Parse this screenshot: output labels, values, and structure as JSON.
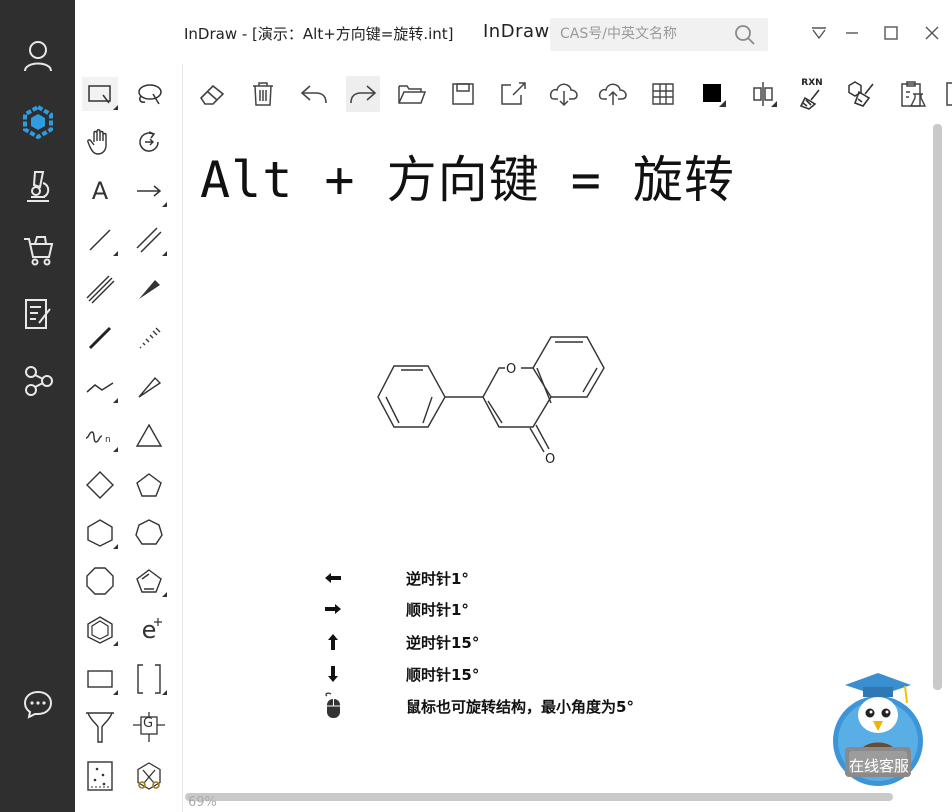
{
  "window": {
    "doc_title": "InDraw - [演示：Alt+方向键=旋转.int]",
    "brand": "InDraw",
    "search_placeholder": "CAS号/中英文名称"
  },
  "nav": {
    "items": [
      {
        "icon": "user-icon"
      },
      {
        "icon": "molecule-logo-icon",
        "active": true
      },
      {
        "icon": "microscope-icon"
      },
      {
        "icon": "cart-icon"
      },
      {
        "icon": "notes-icon"
      },
      {
        "icon": "share-icon"
      },
      {
        "icon": "chat-icon"
      }
    ],
    "active_color": "#2f9be0"
  },
  "toolbar": {
    "rxn_label": "RXN"
  },
  "canvas": {
    "headline": "Alt + 方向键 = 旋转",
    "oxygen_ring": "O",
    "oxygen_carbonyl": "O",
    "shortcuts": [
      {
        "key": "left-arrow",
        "label": "逆时针1°"
      },
      {
        "key": "right-arrow",
        "label": "顺时针1°"
      },
      {
        "key": "up-arrow",
        "label": "逆时针15°"
      },
      {
        "key": "down-arrow",
        "label": "顺时针15°"
      },
      {
        "key": "mouse",
        "label": "鼠标也可旋转结构，最小角度为5°"
      }
    ]
  },
  "status": {
    "zoom": "69%"
  },
  "service": {
    "label": "在线客服"
  },
  "palette": {
    "text_tool_label": "A",
    "electron_label": "e",
    "group_label": "G"
  }
}
